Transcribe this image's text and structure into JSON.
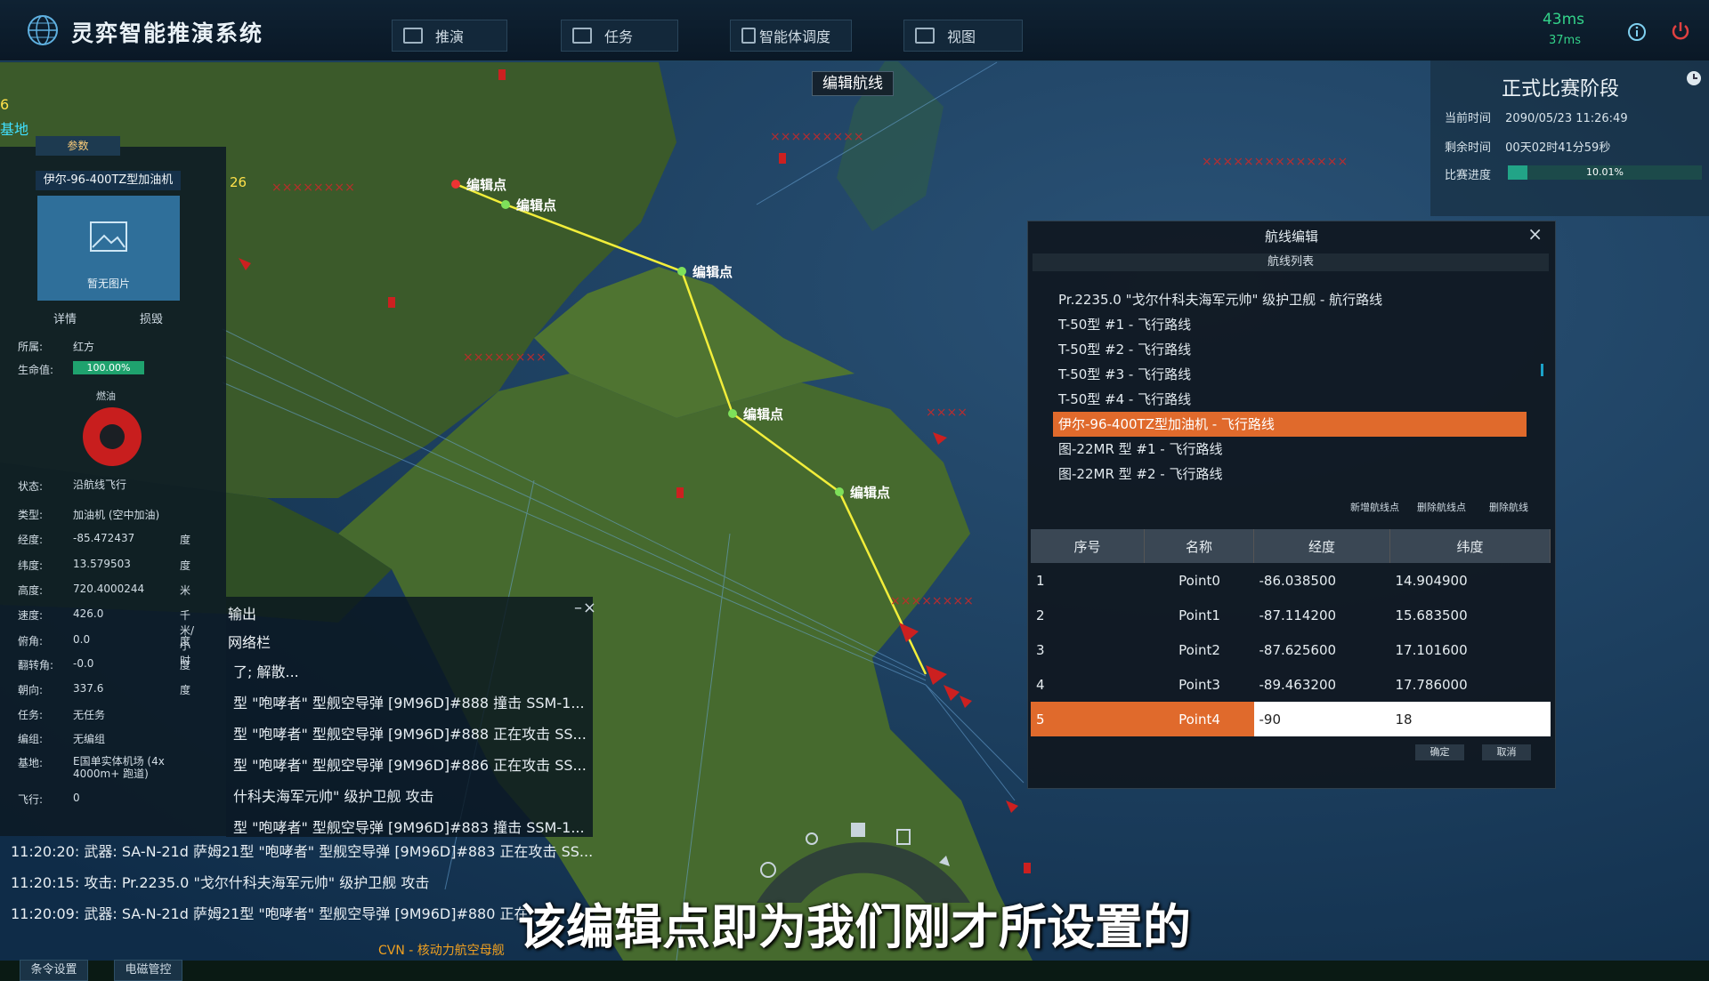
{
  "app": {
    "title": "灵弈智能推演系统",
    "ping_main": "43ms",
    "ping_sub": "37ms"
  },
  "nav": [
    {
      "label": "推演",
      "icon": "play-square-icon"
    },
    {
      "label": "任务",
      "icon": "task-list-icon"
    },
    {
      "label": "智能体调度",
      "icon": "agent-icon"
    },
    {
      "label": "视图",
      "icon": "image-view-icon"
    }
  ],
  "map": {
    "edit_route_label": "编辑航线",
    "waypoint_label": "编辑点",
    "waypoint_count": 6,
    "side_labels": [
      "6",
      "基地",
      "26"
    ]
  },
  "hud": {
    "stage": "正式比赛阶段",
    "current_time_label": "当前时间",
    "current_time": "2090/05/23 11:26:49",
    "remaining_label": "剩余时间",
    "remaining": "00天02时41分59秒",
    "progress_label": "比赛进度",
    "progress_pct": 10.01,
    "progress_text": "10.01%"
  },
  "unit": {
    "tab": "参数",
    "name": "伊尔-96-400TZ型加油机",
    "no_image": "暂无图片",
    "details_btn": "详情",
    "damage_btn": "损毁",
    "faction_label": "所属:",
    "faction": "红方",
    "hp_label": "生命值:",
    "hp": "100.00%",
    "fuel_label": "燃油",
    "fields": [
      {
        "k": "状态:",
        "v": "沿航线飞行",
        "u": ""
      },
      {
        "k": "类型:",
        "v": "加油机 (空中加油)",
        "u": ""
      },
      {
        "k": "经度:",
        "v": "-85.472437",
        "u": "度"
      },
      {
        "k": "纬度:",
        "v": "13.579503",
        "u": "度"
      },
      {
        "k": "高度:",
        "v": "720.4000244",
        "u": "米"
      },
      {
        "k": "速度:",
        "v": "426.0",
        "u": "千米/小时"
      },
      {
        "k": "俯角:",
        "v": "0.0",
        "u": "度"
      },
      {
        "k": "翻转角:",
        "v": "-0.0",
        "u": "度"
      },
      {
        "k": "朝向:",
        "v": "337.6",
        "u": "度"
      },
      {
        "k": "任务:",
        "v": "无任务",
        "u": ""
      },
      {
        "k": "编组:",
        "v": "无编组",
        "u": ""
      },
      {
        "k": "基地:",
        "v": "E国单实体机场 (4x 4000m+ 跑道)",
        "u": ""
      },
      {
        "k": "飞行:",
        "v": "0",
        "u": ""
      }
    ],
    "cmd_btn": "条令设置",
    "em_btn": "电磁管控"
  },
  "log": {
    "title": "输出",
    "subtitle": "网络栏",
    "lines_in_panel": [
      "了;  解散...",
      "型 \"咆哮者\" 型舰空导弹 [9M96D]#888 撞击 SSM-1...",
      "型 \"咆哮者\" 型舰空导弹 [9M96D]#888 正在攻击 SS...",
      "型 \"咆哮者\" 型舰空导弹 [9M96D]#886 正在攻击 SS...",
      "什科夫海军元帅\" 级护卫舰 攻击",
      "型 \"咆哮者\" 型舰空导弹 [9M96D]#883 撞击 SSM-1..."
    ],
    "lines_bottom": [
      "11:20:20: 武器: SA-N-21d 萨姆21型 \"咆哮者\" 型舰空导弹 [9M96D]#883 正在攻击 SS...",
      "11:20:15: 攻击: Pr.2235.0 \"戈尔什科夫海军元帅\" 级护卫舰 攻击",
      "11:20:09: 武器: SA-N-21d 萨姆21型 \"咆哮者\" 型舰空导弹 [9M96D]#880 正在"
    ]
  },
  "dialog": {
    "title": "航线编辑",
    "list_header": "航线列表",
    "routes": [
      "Pr.2235.0 \"戈尔什科夫海军元帅\" 级护卫舰 - 航行路线",
      "T-50型 #1 - 飞行路线",
      "T-50型 #2 - 飞行路线",
      "T-50型 #3 - 飞行路线",
      "T-50型 #4 - 飞行路线",
      "伊尔-96-400TZ型加油机 - 飞行路线",
      "图-22MR 型 #1 - 飞行路线",
      "图-22MR 型 #2 - 飞行路线"
    ],
    "selected_route": 5,
    "btn_new": "新增航线点",
    "btn_del_point": "删除航线点",
    "btn_del_route": "删除航线",
    "columns": [
      "序号",
      "名称",
      "经度",
      "纬度"
    ],
    "points": [
      [
        "1",
        "Point0",
        "-86.038500",
        "14.904900"
      ],
      [
        "2",
        "Point1",
        "-87.114200",
        "15.683500"
      ],
      [
        "3",
        "Point2",
        "-87.625600",
        "17.101600"
      ],
      [
        "4",
        "Point3",
        "-89.463200",
        "17.786000"
      ],
      [
        "5",
        "Point4",
        "-90",
        "18"
      ]
    ],
    "ok": "确定",
    "cancel": "取消"
  },
  "caption": "该编辑点即为我们刚才所设置的",
  "bottom_label": "CVN - 核动力航空母舰"
}
